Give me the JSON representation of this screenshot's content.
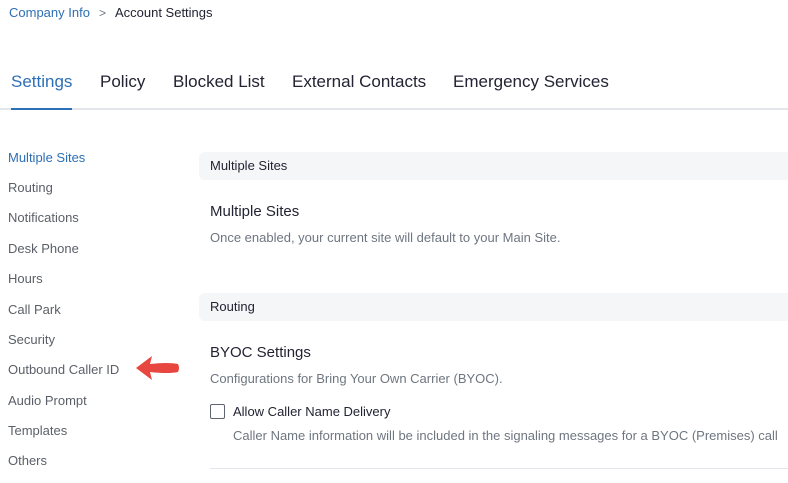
{
  "breadcrumb": {
    "parent": "Company Info",
    "separator": ">",
    "current": "Account Settings"
  },
  "tabs": [
    {
      "label": "Settings",
      "active": true
    },
    {
      "label": "Policy",
      "active": false
    },
    {
      "label": "Blocked List",
      "active": false
    },
    {
      "label": "External Contacts",
      "active": false
    },
    {
      "label": "Emergency Services",
      "active": false
    }
  ],
  "sidebar": {
    "items": [
      {
        "label": "Multiple Sites",
        "active": true
      },
      {
        "label": "Routing",
        "active": false
      },
      {
        "label": "Notifications",
        "active": false
      },
      {
        "label": "Desk Phone",
        "active": false
      },
      {
        "label": "Hours",
        "active": false
      },
      {
        "label": "Call Park",
        "active": false
      },
      {
        "label": "Security",
        "active": false
      },
      {
        "label": "Outbound Caller ID",
        "active": false
      },
      {
        "label": "Audio Prompt",
        "active": false
      },
      {
        "label": "Templates",
        "active": false
      },
      {
        "label": "Others",
        "active": false
      }
    ]
  },
  "annotation": {
    "icon": "red-arrow-icon",
    "color": "#e8473f"
  },
  "sections": {
    "multiple_sites": {
      "header": "Multiple Sites",
      "title": "Multiple Sites",
      "description": "Once enabled, your current site will default to your Main Site."
    },
    "routing": {
      "header": "Routing",
      "title": "BYOC Settings",
      "description": "Configurations for Bring Your Own Carrier (BYOC).",
      "checkbox": {
        "label": "Allow Caller Name Delivery",
        "checked": false,
        "description": "Caller Name information will be included in the signaling messages for a BYOC (Premises) call"
      }
    }
  },
  "colors": {
    "accent": "#2d6fb5",
    "text": "#232333",
    "muted": "#6e7680",
    "header_bg": "#f5f6f8"
  }
}
